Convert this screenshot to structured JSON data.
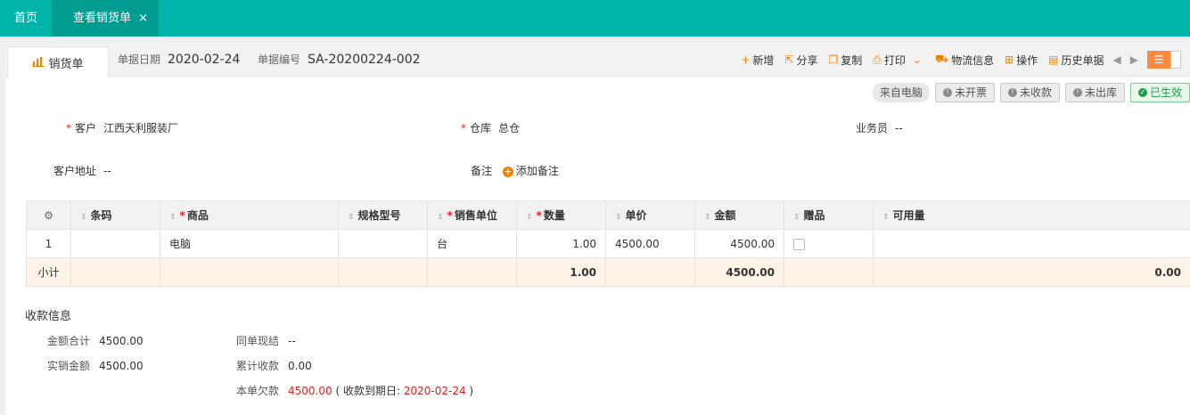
{
  "top_tabs": [
    {
      "label": "首页"
    },
    {
      "label": "查看销货单",
      "close": "×"
    }
  ],
  "doc": {
    "tab_label": "销货单",
    "date_label": "单据日期",
    "date_value": "2020-02-24",
    "number_label": "单据编号",
    "number_value": "SA-20200224-002"
  },
  "toolbar": {
    "new": "新增",
    "share": "分享",
    "copy": "复制",
    "print": "打印",
    "logistics": "物流信息",
    "operate": "操作",
    "history": "历史单据"
  },
  "badges": {
    "source": "来自电脑",
    "invoice": "未开票",
    "receipt": "未收款",
    "outbound": "未出库",
    "effective": "已生效"
  },
  "form": {
    "customer_label": "客户",
    "customer_value": "江西天利服装厂",
    "warehouse_label": "仓库",
    "warehouse_value": "总仓",
    "salesman_label": "业务员",
    "salesman_value": "--",
    "address_label": "客户地址",
    "address_value": "--",
    "note_label": "备注",
    "note_add": "添加备注"
  },
  "table": {
    "headers": [
      "条码",
      "商品",
      "规格型号",
      "销售单位",
      "数量",
      "单价",
      "金额",
      "赠品",
      "可用量"
    ],
    "rows": [
      {
        "index": "1",
        "barcode": "",
        "product": "电脑",
        "spec": "",
        "unit": "台",
        "qty": "1.00",
        "price": "4500.00",
        "amount": "4500.00",
        "available": ""
      }
    ],
    "subtotal": {
      "label": "小计",
      "qty": "1.00",
      "amount": "4500.00",
      "available": "0.00"
    }
  },
  "payment": {
    "title": "收款信息",
    "total_label": "金额合计",
    "total_value": "4500.00",
    "actual_label": "实销金额",
    "actual_value": "4500.00",
    "settle_label": "同单现结",
    "settle_value": "--",
    "received_label": "累计收款",
    "received_value": "0.00",
    "owed_label": "本单欠款",
    "owed_value": "4500.00",
    "due_prefix": "( 收款到期日:",
    "due_date": "2020-02-24",
    "due_suffix": ")"
  }
}
